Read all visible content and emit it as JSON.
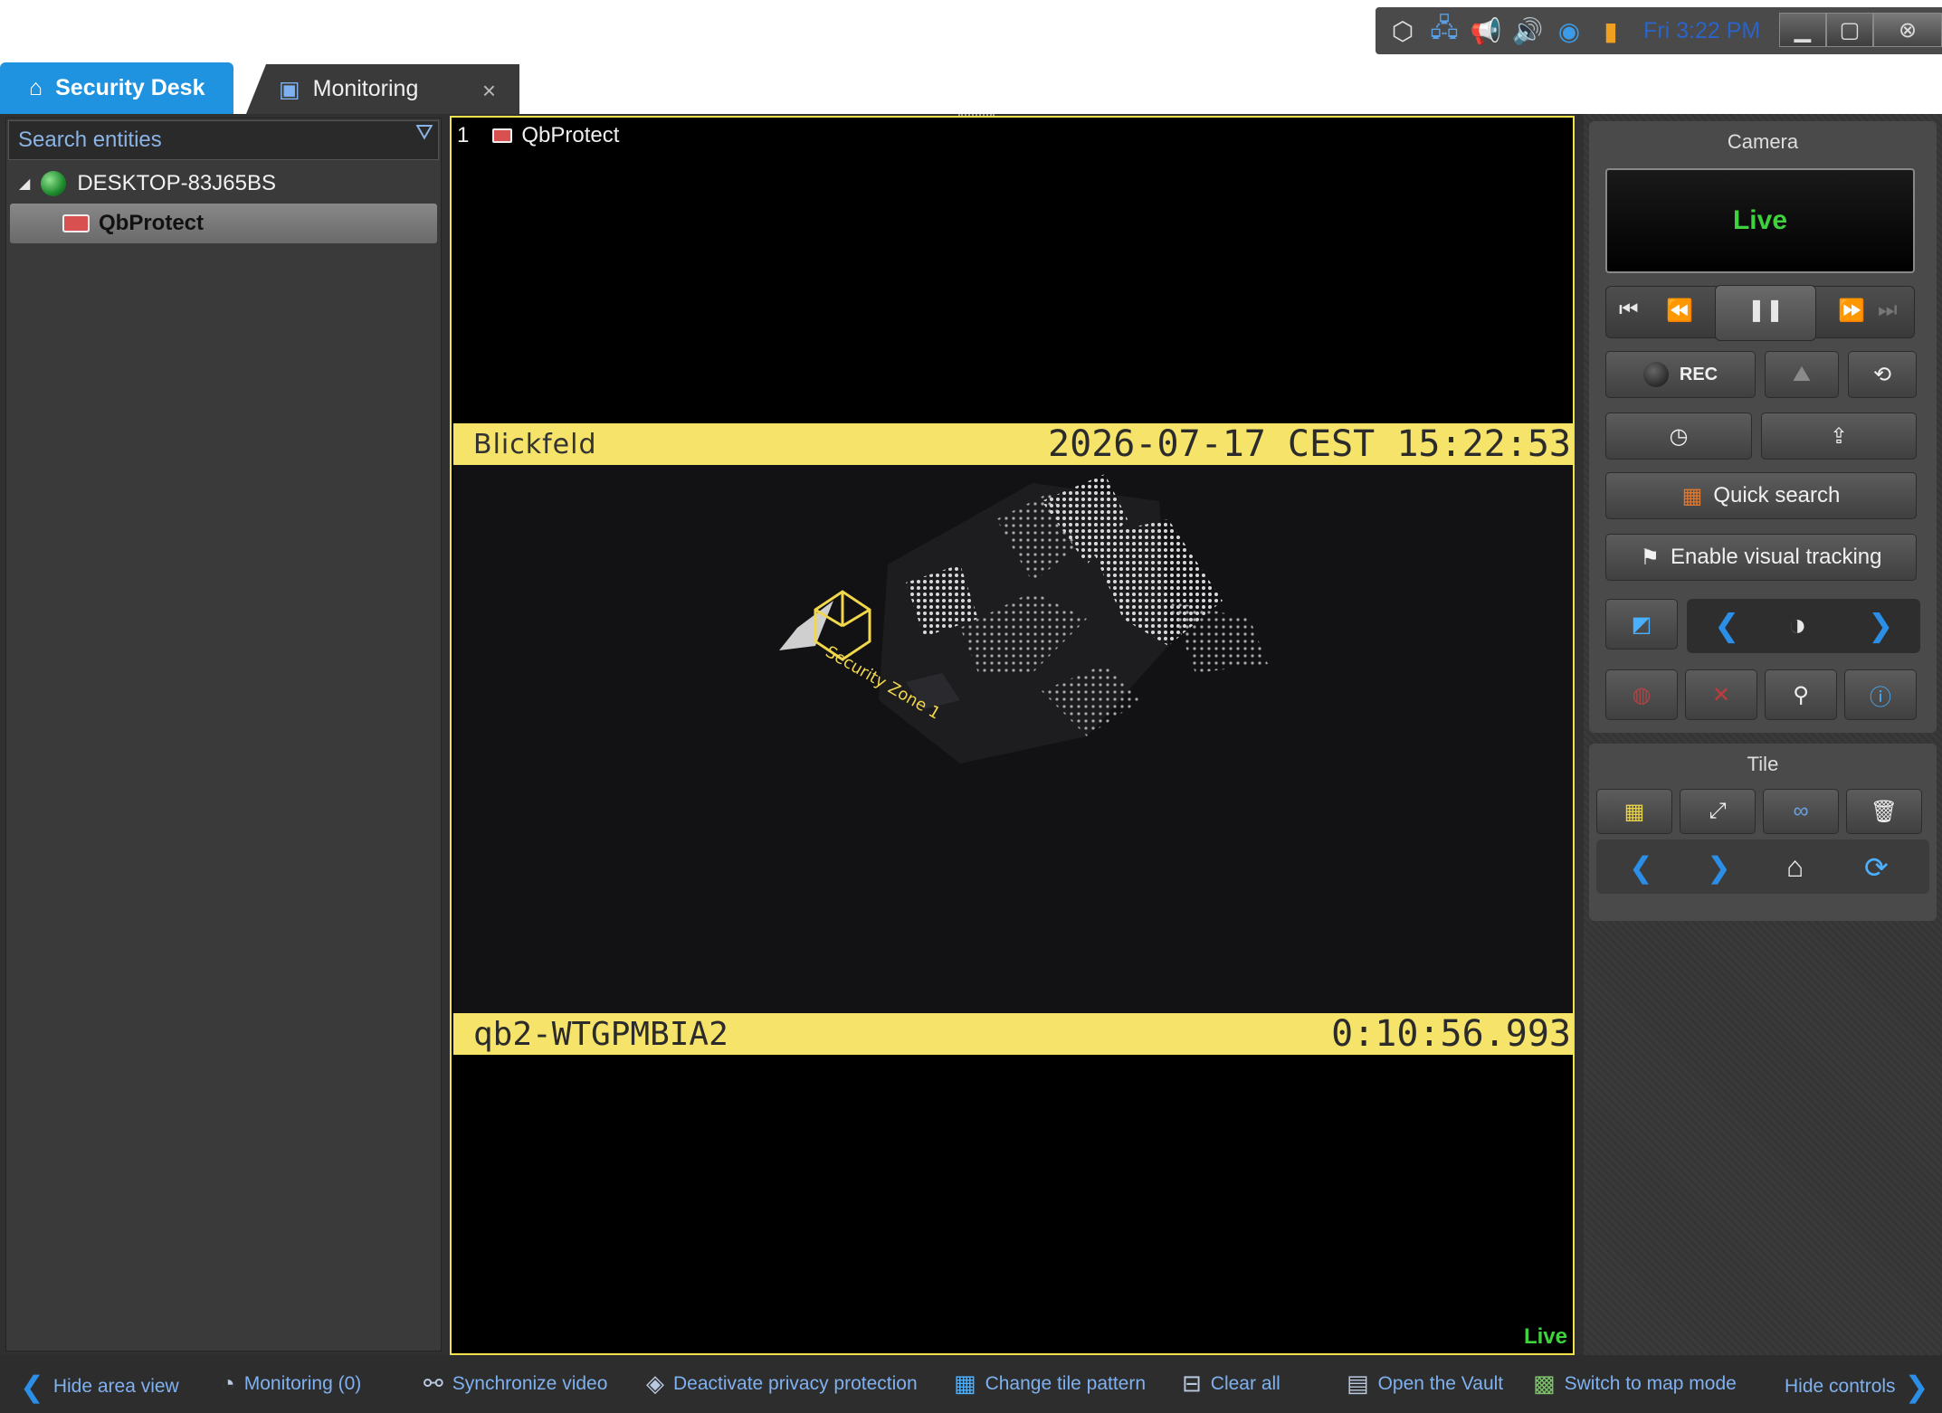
{
  "tray": {
    "clock": "Fri 3:22 PM",
    "icons": [
      "genetec-icon",
      "network-icon",
      "megaphone-icon",
      "volume-icon",
      "globe-icon",
      "battery-icon"
    ]
  },
  "window": {
    "minimize": "▁",
    "maximize": "▢",
    "close": "⊗"
  },
  "tabs": {
    "home": "Security Desk",
    "monitoring": "Monitoring",
    "close": "×"
  },
  "left_panel": {
    "search_placeholder": "Search entities",
    "tree": {
      "root": "DESKTOP-83J65BS",
      "child": "QbProtect"
    }
  },
  "tile": {
    "index": "1",
    "camera": "QbProtect",
    "band_top": {
      "logo": "Blickfeld",
      "datetime": "2026-07-17 CEST 15:22:53"
    },
    "band_bottom": {
      "device": "qb2-WTGPMBIA2",
      "elapsed": "0:10:56.993"
    },
    "zone_label": "Security Zone 1",
    "status": "Live"
  },
  "camera_panel": {
    "title": "Camera",
    "status": "Live",
    "rec": "REC",
    "quick_search": "Quick search",
    "visual_tracking": "Enable visual tracking"
  },
  "tile_panel": {
    "title": "Tile"
  },
  "toolbar": {
    "hide_area": "Hide area view",
    "monitoring": "Monitoring (0)",
    "sync": "Synchronize video",
    "privacy": "Deactivate privacy protection",
    "pattern": "Change tile pattern",
    "clear": "Clear all",
    "vault": "Open the Vault",
    "map": "Switch to map mode",
    "hide_controls": "Hide controls"
  },
  "colors": {
    "accent": "#1f93e0",
    "tile_border": "#f2e24c",
    "overlay_band": "#f6e36a",
    "live": "#3ed23e",
    "link": "#7fb1f0"
  }
}
